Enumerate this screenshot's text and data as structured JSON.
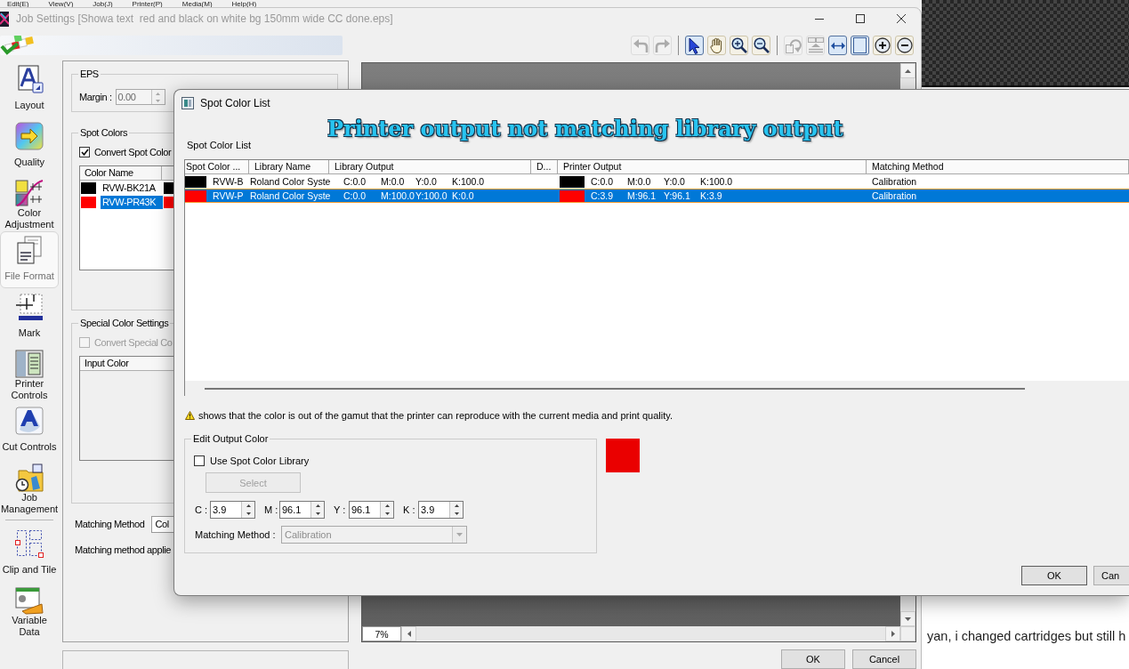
{
  "background_menu": [
    "Edit(E)",
    "View(V)",
    "Job(J)",
    "Printer(P)",
    "Media(M)",
    "Help(H)"
  ],
  "background_page": {
    "text": "yan, i changed cartridges but still h"
  },
  "window": {
    "title": "Job Settings [Showa text  red and black on white bg 150mm wide CC done.eps]",
    "toolbar": [
      {
        "kind": "button",
        "disabled": true,
        "selected": false
      },
      {
        "kind": "button",
        "disabled": true,
        "selected": false
      },
      {
        "kind": "separator"
      },
      {
        "kind": "button",
        "disabled": false,
        "selected": true
      },
      {
        "kind": "button",
        "disabled": false,
        "selected": false
      },
      {
        "kind": "button",
        "disabled": false,
        "selected": false
      },
      {
        "kind": "button",
        "disabled": false,
        "selected": false
      },
      {
        "kind": "separator"
      },
      {
        "kind": "button",
        "disabled": true,
        "selected": false
      },
      {
        "kind": "button",
        "disabled": true,
        "selected": false
      },
      {
        "kind": "button",
        "disabled": false,
        "selected": true
      },
      {
        "kind": "button",
        "disabled": false,
        "selected": true
      },
      {
        "kind": "button",
        "disabled": false,
        "selected": false
      },
      {
        "kind": "button",
        "disabled": false,
        "selected": false
      }
    ],
    "sidebar": [
      {
        "label": "Layout",
        "selected": false
      },
      {
        "label": "Quality",
        "selected": false
      },
      {
        "label": "Color Adjustment",
        "selected": false
      },
      {
        "label": "File Format",
        "selected": true
      },
      {
        "label": "Mark",
        "selected": false
      },
      {
        "label": "Printer Controls",
        "selected": false
      },
      {
        "label": "Cut Controls",
        "selected": false
      },
      {
        "label": "Job Management",
        "selected": false
      },
      {
        "label": "Clip and Tile",
        "selected": false
      },
      {
        "label": "Variable Data",
        "selected": false
      }
    ],
    "settings": {
      "eps": {
        "title": "EPS",
        "margin": {
          "label": "Margin :",
          "value": "0.00",
          "disabled": true
        }
      },
      "spot_colors": {
        "title": "Spot Colors",
        "convert": {
          "label": "Convert Spot Color",
          "checked": true
        },
        "columns": [
          "Color Name"
        ],
        "rows": [
          {
            "color": "#000000",
            "name": "RVW-BK21A",
            "output": {
              "color": "#000000"
            },
            "selected": false
          },
          {
            "color": "#ff0000",
            "name": "RVW-PR43K",
            "output": {
              "color": "#ff0000"
            },
            "selected": true
          }
        ]
      },
      "special_colors": {
        "title": "Special Color Settings",
        "convert": {
          "label": "Convert Special Co",
          "checked": false,
          "disabled": true
        },
        "columns": [
          "Input Color"
        ]
      },
      "matching_method": {
        "label": "Matching Method",
        "value": "Col"
      },
      "note": "Matching method applie"
    },
    "preview": {
      "zoom": "7%"
    },
    "buttons": [
      {
        "label": "OK"
      },
      {
        "label": "Cancel"
      }
    ]
  },
  "dialog": {
    "title": "Spot Color List",
    "annotation": "Printer output not matching library output",
    "list_label": "Spot Color List",
    "columns": [
      "Spot Color ...",
      "Library Name",
      "Library Output",
      "D...",
      "Printer Output",
      "Matching Method"
    ],
    "rows": [
      {
        "color": "#000000",
        "name": "RVW-B",
        "library_name": "Roland Color Syste",
        "library_output": [
          "C:0.0",
          "M:0.0",
          "Y:0.0",
          "K:100.0"
        ],
        "printer_output": {
          "color": "#000000",
          "values": [
            "C:0.0",
            "M:0.0",
            "Y:0.0",
            "K:100.0"
          ]
        },
        "matching_method": "Calibration",
        "selected": false
      },
      {
        "color": "#ff0000",
        "name": "RVW-P",
        "library_name": "Roland Color Syste",
        "library_output": [
          "C:0.0",
          "M:100.0",
          "Y:100.0",
          "K:0.0"
        ],
        "printer_output": {
          "color": "#ff0000",
          "values": [
            "C:3.9",
            "M:96.1",
            "Y:96.1",
            "K:3.9"
          ]
        },
        "matching_method": "Calibration",
        "selected": true
      }
    ],
    "warning": "shows that the color is out of the gamut that the printer can reproduce with the current media and print quality.",
    "edit_output_color": {
      "title": "Edit Output Color",
      "use_library": {
        "label": "Use Spot Color Library",
        "checked": false
      },
      "select": {
        "label": "Select",
        "disabled": true
      },
      "values": [
        {
          "label": "C :",
          "value": "3.9"
        },
        {
          "label": "M :",
          "value": "96.1"
        },
        {
          "label": "Y :",
          "value": "96.1"
        },
        {
          "label": "K :",
          "value": "3.9"
        }
      ],
      "matching_method": {
        "label": "Matching Method :",
        "value": "Calibration",
        "disabled": true
      }
    },
    "preview_swatch": {
      "color": "#ea0000"
    },
    "buttons": [
      {
        "label": "OK"
      },
      {
        "label": "Can"
      }
    ]
  }
}
